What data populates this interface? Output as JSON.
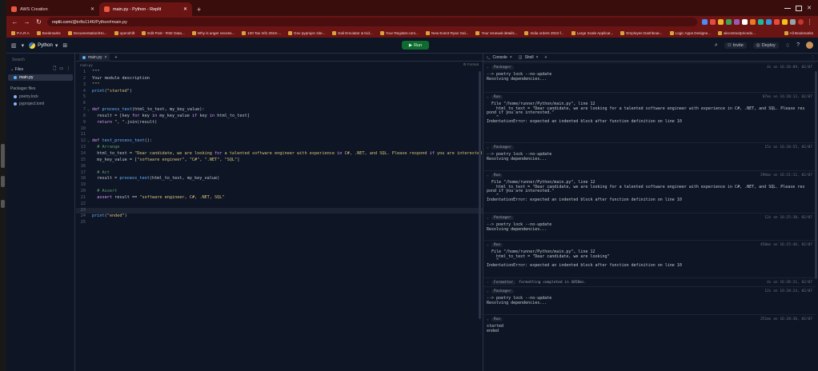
{
  "browser": {
    "tabs": [
      {
        "title": "AWS Creation",
        "active": false
      },
      {
        "title": "main.py - Python - Replit",
        "active": true
      }
    ],
    "url_host": "replit.com",
    "url_path": "/@infts1146/Python#main.py",
    "bookmarks": [
      "P.A.R.A",
      "Bookmarks",
      "Documentation/Ho...",
      "openshift",
      "Edit Post - RStr Data...",
      "Why is anger necess...",
      "100 Tax Info 2019-...",
      "Gov pyprojec site...",
      "Kali Emulator & Kid...",
      "Your Register.com...",
      "New Event Ryan Gal...",
      "Your renewal details...",
      "India orders 2024 f...",
      "Large Scale Applicat...",
      "Employee Dashboar...",
      "Logic Apps Designe...",
      "akcontractpricedo...",
      "All Bookmarks"
    ],
    "accent": "#6b1414"
  },
  "header": {
    "repl_name": "Python",
    "run_label": "Run",
    "invite_label": "Invite",
    "deploy_label": "Deploy"
  },
  "sidebar": {
    "search_placeholder": "Search",
    "files_label": "Files",
    "files": [
      "main.py"
    ],
    "packager_label": "Packager files",
    "packager_files": [
      "poetry.lock",
      "pyproject.toml"
    ]
  },
  "editor": {
    "tab": "main.py",
    "breadcrumb": "main.py",
    "format_label": "Format",
    "lines": [
      {
        "n": "1",
        "t": "\"\"\""
      },
      {
        "n": "2",
        "t": "Your module description"
      },
      {
        "n": "3",
        "t": "\"\"\""
      },
      {
        "n": "4",
        "t": "print(\"started\")"
      },
      {
        "n": "5",
        "t": ""
      },
      {
        "n": "6",
        "t": ""
      },
      {
        "n": "7",
        "t": "def process_text(html_to_text, my_key_value):"
      },
      {
        "n": "8",
        "t": "  result = [key for key in my_key_value if key in html_to_text]"
      },
      {
        "n": "9",
        "t": "  return \", \".join(result)"
      },
      {
        "n": "10",
        "t": ""
      },
      {
        "n": "11",
        "t": ""
      },
      {
        "n": "12",
        "t": "def test_process_text():"
      },
      {
        "n": "13",
        "t": "  # Arrange"
      },
      {
        "n": "14",
        "t": "  html_to_text = \"Dear candidate, we are looking for a talented software engineer with experience in C#, .NET, and SQL. Please respond if you are interested.\""
      },
      {
        "n": "15",
        "t": "  my_key_value = [\"software engineer\", \"C#\", \".NET\", \"SQL\"]"
      },
      {
        "n": "16",
        "t": ""
      },
      {
        "n": "17",
        "t": "  # Act"
      },
      {
        "n": "18",
        "t": "  result = process_text(html_to_text, my_key_value)"
      },
      {
        "n": "19",
        "t": ""
      },
      {
        "n": "20",
        "t": "  # Assert"
      },
      {
        "n": "21",
        "t": "  assert result == \"software engineer, C#, .NET, SQL\""
      },
      {
        "n": "22",
        "t": ""
      },
      {
        "n": "23",
        "t": ""
      },
      {
        "n": "24",
        "t": "print(\"ended\")"
      },
      {
        "n": "25",
        "t": ""
      }
    ]
  },
  "console": {
    "tab_console": "Console",
    "tab_shell": "Shell",
    "entries": [
      {
        "badge": "Packager",
        "msg": "",
        "time": "4s on 16:20:09, 02/07",
        "out": "--> poetry lock --no-update\nResolving dependencies..."
      },
      {
        "badge": "Run",
        "msg": "",
        "time": "87ms on 16:20:12, 02/07",
        "out": "  File \"/home/runner/Python/main.py\", line 12\n    html_to_text = \"Dear candidate, we are looking for a talented software engineer with experience in C#, .NET, and SQL. Please res\npond if you are interested.\"\n    ^\nIndentationError: expected an indented block after function definition on line 10"
      },
      {
        "badge": "Packager",
        "msg": "",
        "time": "15s on 16:20:55, 02/07",
        "out": "--> poetry lock --no-update\nResolving dependencies..."
      },
      {
        "badge": "Run",
        "msg": "",
        "time": "296ms on 16:21:11, 02/07",
        "out": "  File \"/home/runner/Python/main.py\", line 12\n    html_to_text = \"Dear candidate, we are looking for a talented software engineer with experience in C#, .NET, and SQL. Please res\npond if you are interested.\"\n    ^\nIndentationError: expected an indented block after function definition on line 10"
      },
      {
        "badge": "Packager",
        "msg": "",
        "time": "12s on 16:25:30, 02/07",
        "out": "--> poetry lock --no-update\nResolving dependencies..."
      },
      {
        "badge": "Run",
        "msg": "",
        "time": "450ms on 16:25:46, 02/07",
        "out": "  File \"/home/runner/Python/main.py\", line 12\n    html_to_text = \"Dear candidate, we are looking\"\n    ^\nIndentationError: expected an indented block after function definition on line 10"
      },
      {
        "badge": "Formatter",
        "msg": "Formatting completed in 4858ms.",
        "time": "4s on 16:28:21, 02/07",
        "out": ""
      },
      {
        "badge": "Packager",
        "msg": "",
        "time": "12s on 16:28:24, 02/07",
        "out": "--> poetry lock --no-update\nResolving dependencies..."
      },
      {
        "badge": "Run",
        "msg": "",
        "time": "251ms on 16:28:36, 02/07",
        "out": "started\nended"
      }
    ]
  }
}
